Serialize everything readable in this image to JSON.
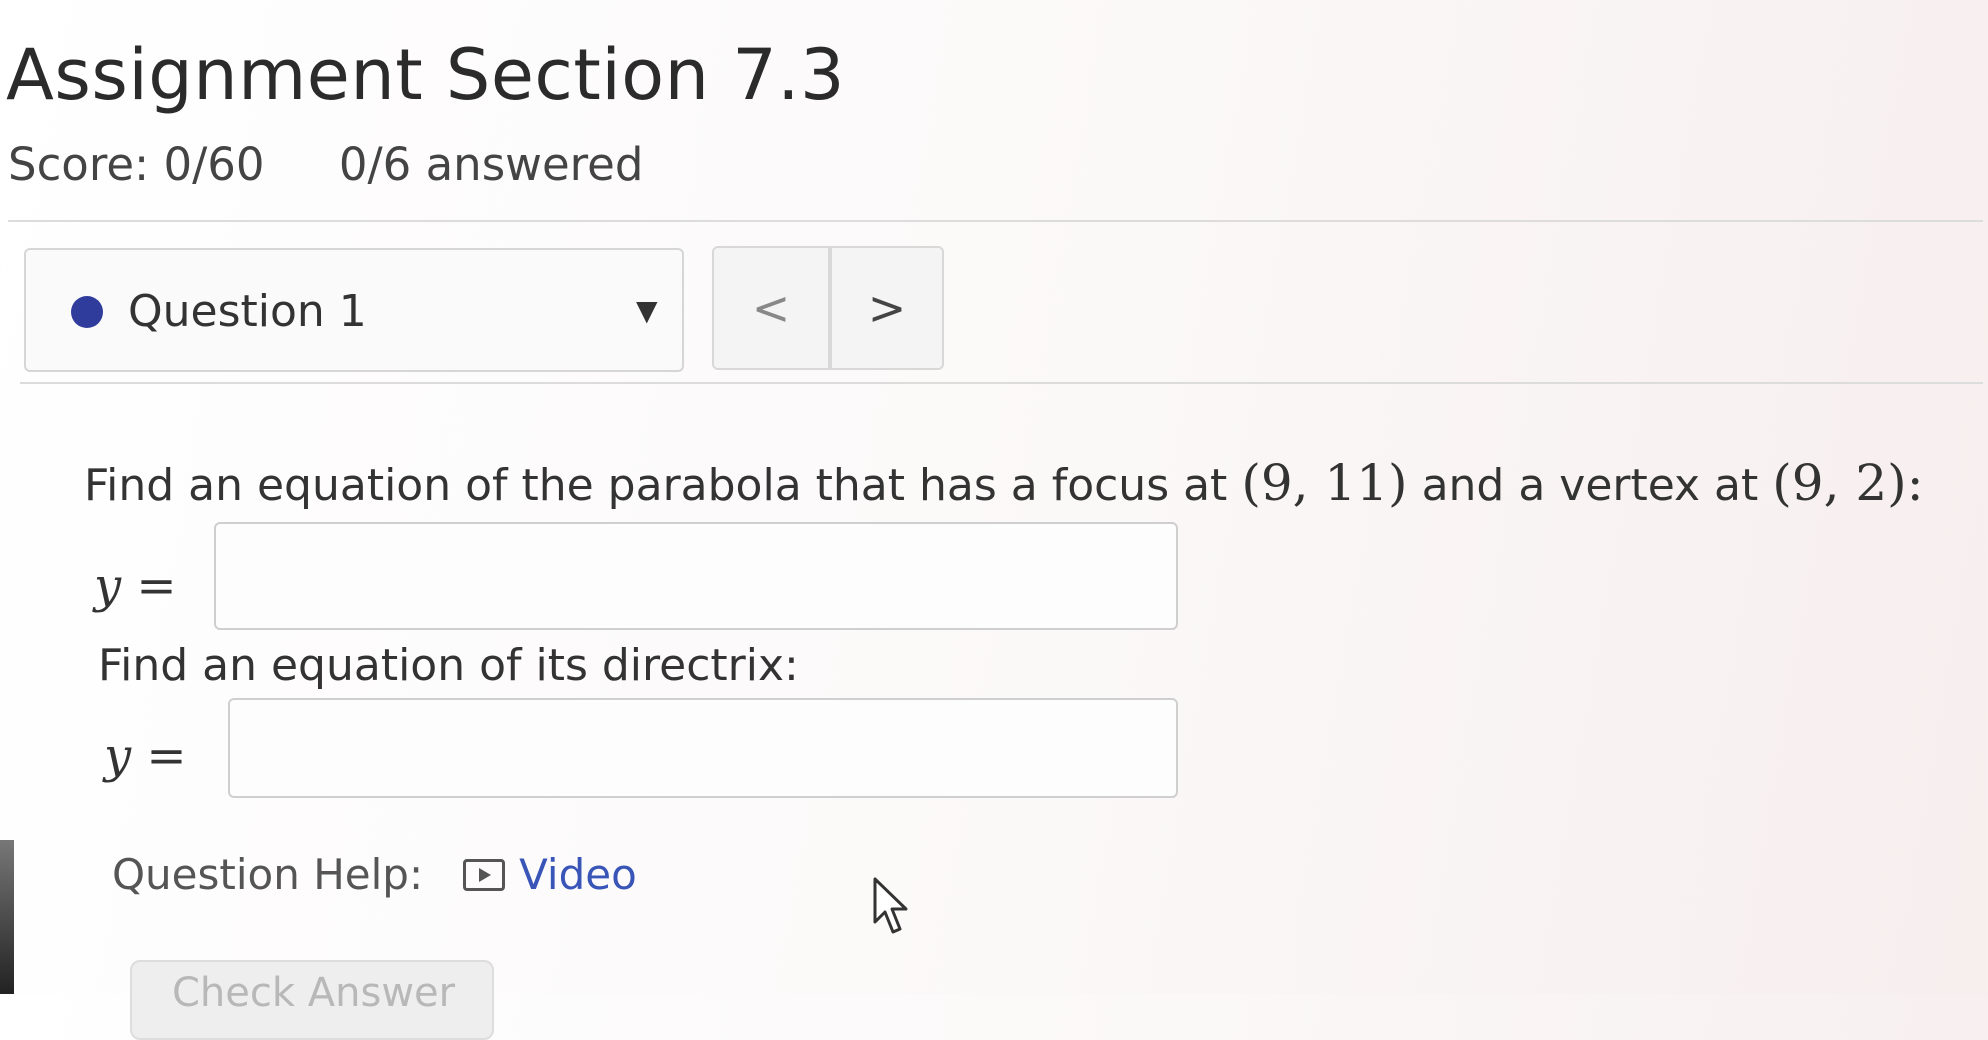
{
  "header": {
    "title": "Assignment Section 7.3",
    "score": "Score: 0/60",
    "answered": "0/6 answered"
  },
  "question_nav": {
    "current": "Question 1",
    "status_color": "#2f3c9c",
    "dropdown_icon": "caret-down-icon",
    "prev_label": "<",
    "next_label": ">"
  },
  "question": {
    "prompt_pre": "Find an equation of the parabola that has a focus at",
    "focus": "(9, 11)",
    "prompt_mid": "and a vertex at",
    "vertex": "(9, 2)",
    "prompt_end": ":",
    "answer_label": "y =",
    "answer_value": "",
    "directrix_prompt": "Find an equation of its directrix:",
    "directrix_label": "y =",
    "directrix_value": ""
  },
  "help": {
    "label": "Question Help:",
    "video_icon": "video-icon",
    "video_label": "Video",
    "link_color": "#3a55b8"
  },
  "actions": {
    "check_label": "Check Answer"
  }
}
